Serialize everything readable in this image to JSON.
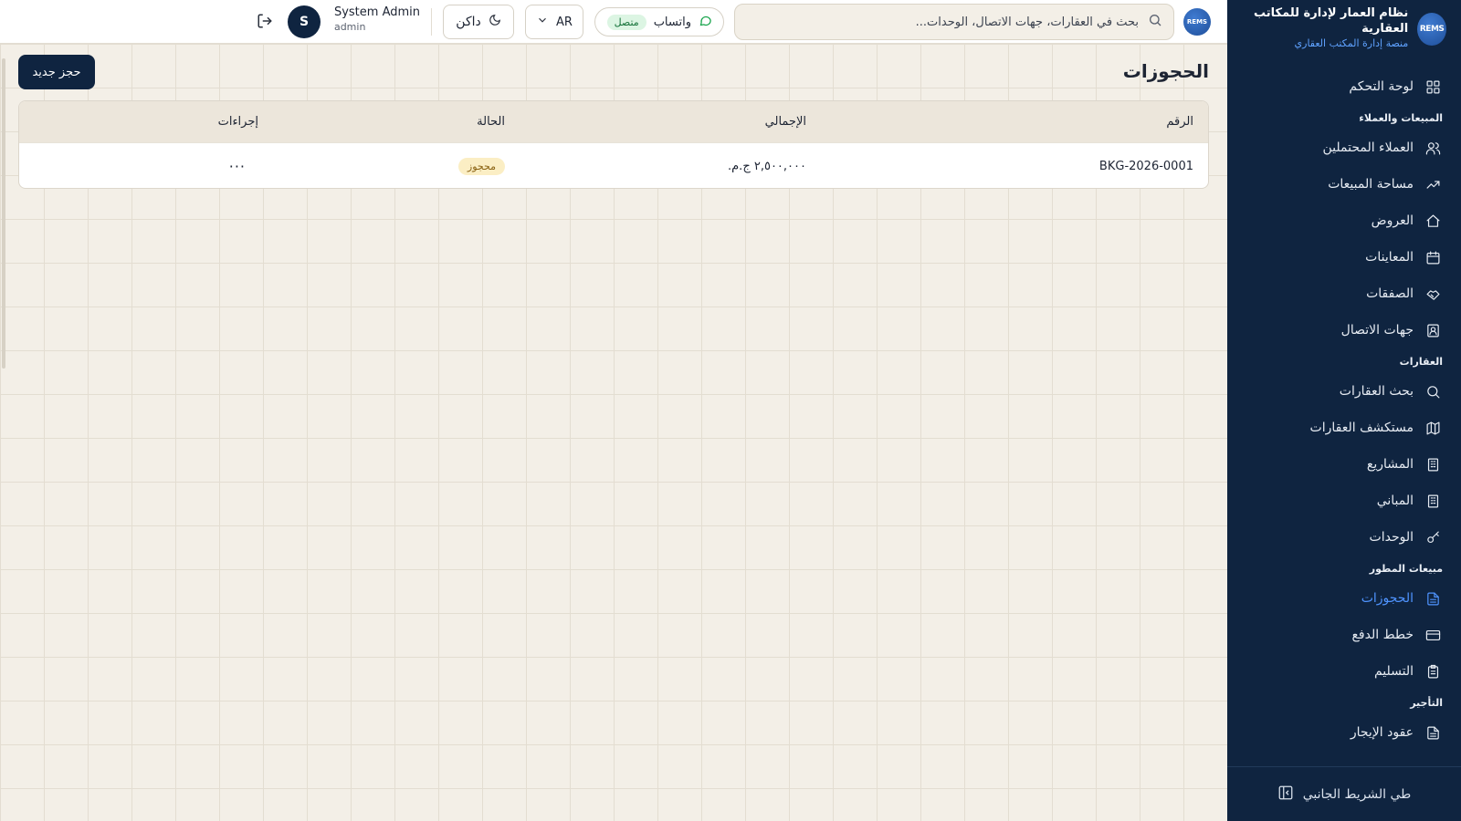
{
  "brand": {
    "logo_text": "REMS",
    "name": "نظام العمار لإدارة للمكاتب العقارية",
    "subtitle": "منصة إدارة المكتب العقاري"
  },
  "sidebar": {
    "items": [
      {
        "type": "item",
        "label": "لوحة التحكم",
        "icon": "dashboard-icon"
      },
      {
        "type": "group",
        "label": "المبيعات والعملاء"
      },
      {
        "type": "item",
        "label": "العملاء المحتملين",
        "icon": "users-icon"
      },
      {
        "type": "item",
        "label": "مساحة المبيعات",
        "icon": "trending-up-icon"
      },
      {
        "type": "item",
        "label": "العروض",
        "icon": "home-icon"
      },
      {
        "type": "item",
        "label": "المعاينات",
        "icon": "calendar-icon"
      },
      {
        "type": "item",
        "label": "الصفقات",
        "icon": "handshake-icon"
      },
      {
        "type": "item",
        "label": "جهات الاتصال",
        "icon": "contact-icon"
      },
      {
        "type": "group",
        "label": "العقارات"
      },
      {
        "type": "item",
        "label": "بحث العقارات",
        "icon": "search-icon"
      },
      {
        "type": "item",
        "label": "مستكشف العقارات",
        "icon": "map-icon"
      },
      {
        "type": "item",
        "label": "المشاريع",
        "icon": "building-icon"
      },
      {
        "type": "item",
        "label": "المباني",
        "icon": "building-icon"
      },
      {
        "type": "item",
        "label": "الوحدات",
        "icon": "key-icon"
      },
      {
        "type": "group",
        "label": "مبيعات المطور"
      },
      {
        "type": "item",
        "label": "الحجوزات",
        "icon": "file-text-icon",
        "active": true
      },
      {
        "type": "item",
        "label": "خطط الدفع",
        "icon": "credit-card-icon"
      },
      {
        "type": "item",
        "label": "التسليم",
        "icon": "clipboard-icon"
      },
      {
        "type": "group",
        "label": "التأجير"
      },
      {
        "type": "item",
        "label": "عقود الإيجار",
        "icon": "file-text-icon"
      }
    ],
    "collapse_label": "طي الشريط الجانبي"
  },
  "topbar": {
    "avatar_text": "REMS",
    "search_placeholder": "بحث في العقارات، جهات الاتصال، الوحدات...",
    "whatsapp_label": "واتساب",
    "whatsapp_status": "متصل",
    "language": "AR",
    "theme_label": "داكن",
    "user_name": "System Admin",
    "user_role": "admin",
    "user_initial": "S"
  },
  "page": {
    "title": "الحجوزات",
    "new_button": "حجز جديد"
  },
  "table": {
    "headers": [
      "الرقم",
      "الإجمالي",
      "الحالة",
      "إجراءات"
    ],
    "rows": [
      {
        "number": "BKG-2026-0001",
        "total": "٢,٥٠٠,٠٠٠ ج.م.",
        "status": "محجوز",
        "actions": "···"
      }
    ]
  },
  "colors": {
    "sidebar_bg": "#0f2440",
    "active": "#4f94ff",
    "accent_button": "#0f2440",
    "status_badge_bg": "#fbeec4"
  }
}
